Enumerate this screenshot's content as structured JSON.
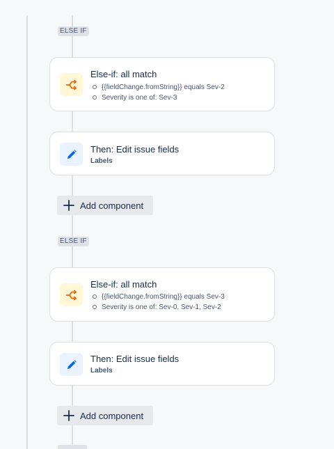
{
  "blocks": [
    {
      "lozenge": "ELSE IF",
      "condition": {
        "icon": "branch-icon",
        "title": "Else-if: all match",
        "items": [
          "{{fieldChange.fromString}} equals Sev-2",
          "Severity is one of: Sev-3"
        ]
      },
      "action": {
        "icon": "pencil-icon",
        "title": "Then: Edit issue fields",
        "subtitle": "Labels"
      },
      "add_label": "Add component"
    },
    {
      "lozenge": "ELSE IF",
      "condition": {
        "icon": "branch-icon",
        "title": "Else-if: all match",
        "items": [
          "{{fieldChange.fromString}} equals Sev-3",
          "Severity is one of: Sev-0, Sev-1, Sev-2"
        ]
      },
      "action": {
        "icon": "pencil-icon",
        "title": "Then: Edit issue fields",
        "subtitle": "Labels"
      },
      "add_label": "Add component"
    }
  ],
  "colors": {
    "condition_icon": "#e56910",
    "action_icon": "#0c66e4",
    "background": "#f7f8f9"
  }
}
